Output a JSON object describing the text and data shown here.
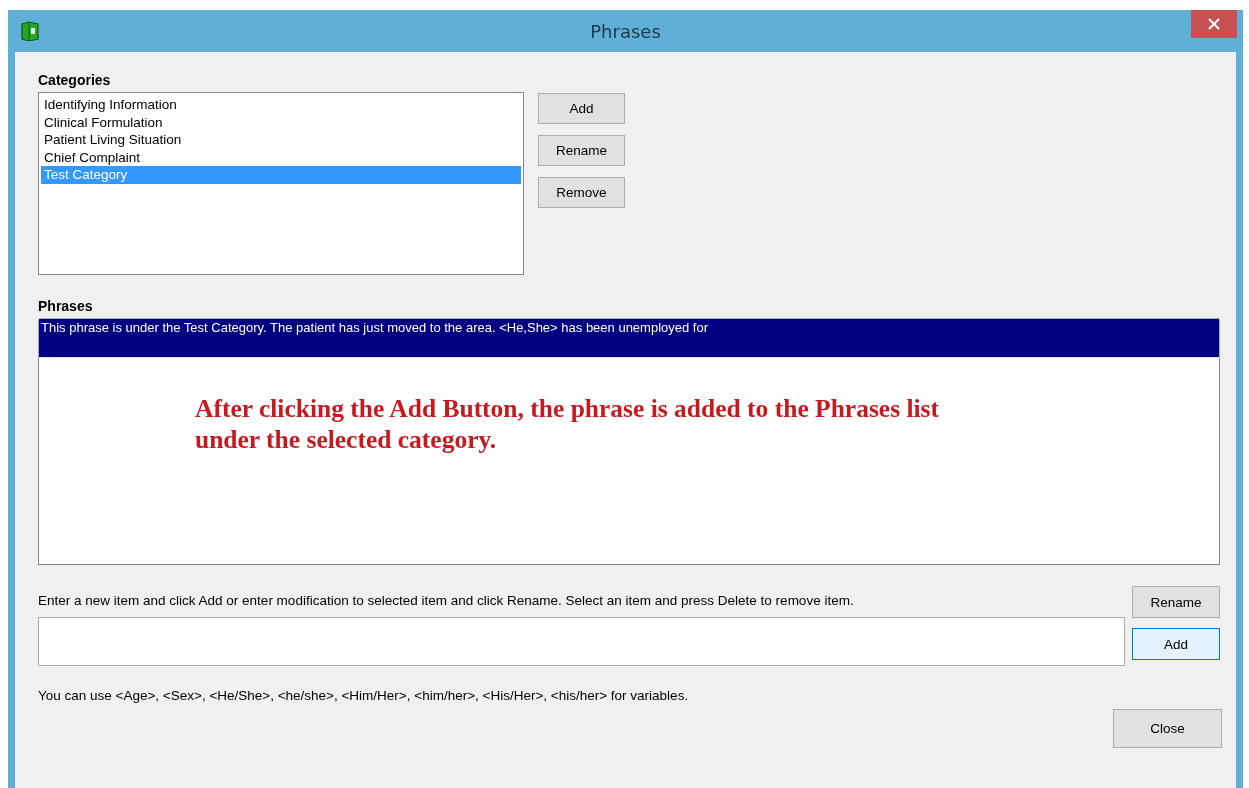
{
  "window": {
    "title": "Phrases"
  },
  "categories": {
    "label": "Categories",
    "items": [
      {
        "text": "Identifying Information",
        "selected": false
      },
      {
        "text": "Clinical Formulation",
        "selected": false
      },
      {
        "text": "Patient Living Situation",
        "selected": false
      },
      {
        "text": "Chief Complaint",
        "selected": false
      },
      {
        "text": "Test Category",
        "selected": true
      }
    ],
    "buttons": [
      "Add",
      "Rename",
      "Remove"
    ]
  },
  "phrases": {
    "label": "Phrases",
    "items": [
      {
        "text": "This phrase is under the Test Category.  The patient has just moved to the area. <He,She> has been unemployed for",
        "selected": true
      }
    ],
    "annotation": "After clicking the Add Button, the phrase is added to the Phrases list under the selected category."
  },
  "editor": {
    "instructions": "Enter a new item and click Add or enter modification to selected item and click Rename. Select an item and press Delete to remove item.",
    "buttons": [
      {
        "label": "Rename",
        "focused": false
      },
      {
        "label": "Add",
        "focused": true
      }
    ],
    "hint": "You can use <Age>, <Sex>, <He/She>, <he/she>, <Him/Her>, <him/her>, <His/Her>, <his/her> for variables."
  },
  "close_button": "Close"
}
